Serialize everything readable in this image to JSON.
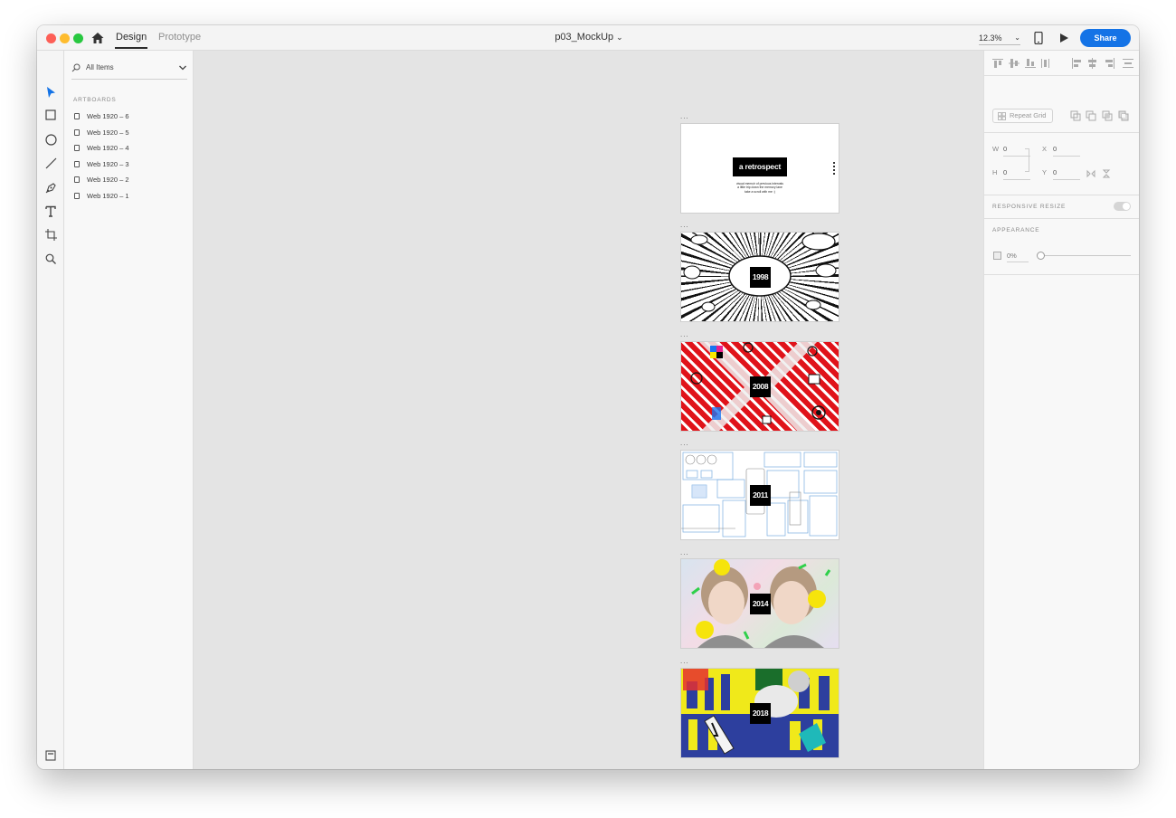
{
  "app": {
    "modes": {
      "design": "Design",
      "prototype": "Prototype"
    },
    "document_title": "p03_MockUp",
    "zoom": "12.3%",
    "share_label": "Share"
  },
  "toolbar": {
    "tools": [
      "select-tool",
      "rectangle-tool",
      "ellipse-tool",
      "line-tool",
      "pen-tool",
      "text-tool",
      "artboard-tool",
      "zoom-tool"
    ],
    "bottom": [
      "assets-panel",
      "layers-panel"
    ]
  },
  "left_panel": {
    "search": {
      "label": "All Items"
    },
    "section_title": "ARTBOARDS",
    "artboards": [
      {
        "label": "Web 1920 – 6"
      },
      {
        "label": "Web 1920 – 5"
      },
      {
        "label": "Web 1920 – 4"
      },
      {
        "label": "Web 1920 – 3"
      },
      {
        "label": "Web 1920 – 2"
      },
      {
        "label": "Web 1920 – 1"
      }
    ]
  },
  "canvas": {
    "artboard_handle_label": "...",
    "artboards": [
      {
        "title": "a retrospect",
        "lines": [
          "visual memoir of previous intervals",
          "a little trip down the memory lane",
          "take a scroll with me :)"
        ],
        "theme": "white"
      },
      {
        "badge": "1998",
        "theme": "comic burst"
      },
      {
        "badge": "2008",
        "theme": "red stripes"
      },
      {
        "badge": "2011",
        "theme": "wireframes"
      },
      {
        "badge": "2014",
        "theme": "portraits"
      },
      {
        "badge": "2018",
        "theme": "yellow blue collage"
      }
    ]
  },
  "right_panel": {
    "repeat_grid_label": "Repeat Grid",
    "transform": {
      "w": {
        "label": "W",
        "value": "0"
      },
      "x": {
        "label": "X",
        "value": "0"
      },
      "h": {
        "label": "H",
        "value": "0"
      },
      "y": {
        "label": "Y",
        "value": "0"
      }
    },
    "responsive_resize_label": "RESPONSIVE RESIZE",
    "appearance_label": "APPEARANCE",
    "opacity": "0%"
  }
}
